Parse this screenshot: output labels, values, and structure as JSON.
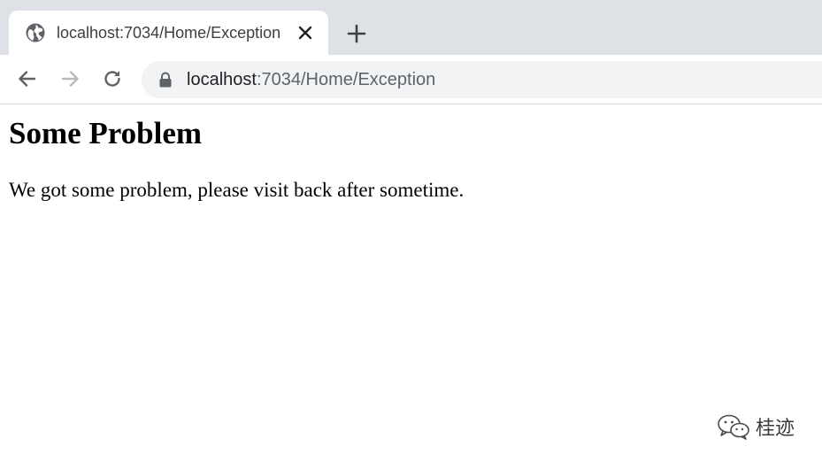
{
  "tab": {
    "title": "localhost:7034/Home/Exception",
    "favicon_icon": "globe-icon",
    "close_icon": "close-icon"
  },
  "new_tab_icon": "plus-icon",
  "toolbar": {
    "back_icon": "arrow-left-icon",
    "forward_icon": "arrow-right-icon",
    "reload_icon": "reload-icon",
    "lock_icon": "lock-icon",
    "url_host": "localhost",
    "url_rest": ":7034/Home/Exception"
  },
  "page": {
    "heading": "Some Problem",
    "message": "We got some problem, please visit back after sometime."
  },
  "watermark": {
    "text": "桂迹",
    "logo_icon": "wechat-icon"
  }
}
